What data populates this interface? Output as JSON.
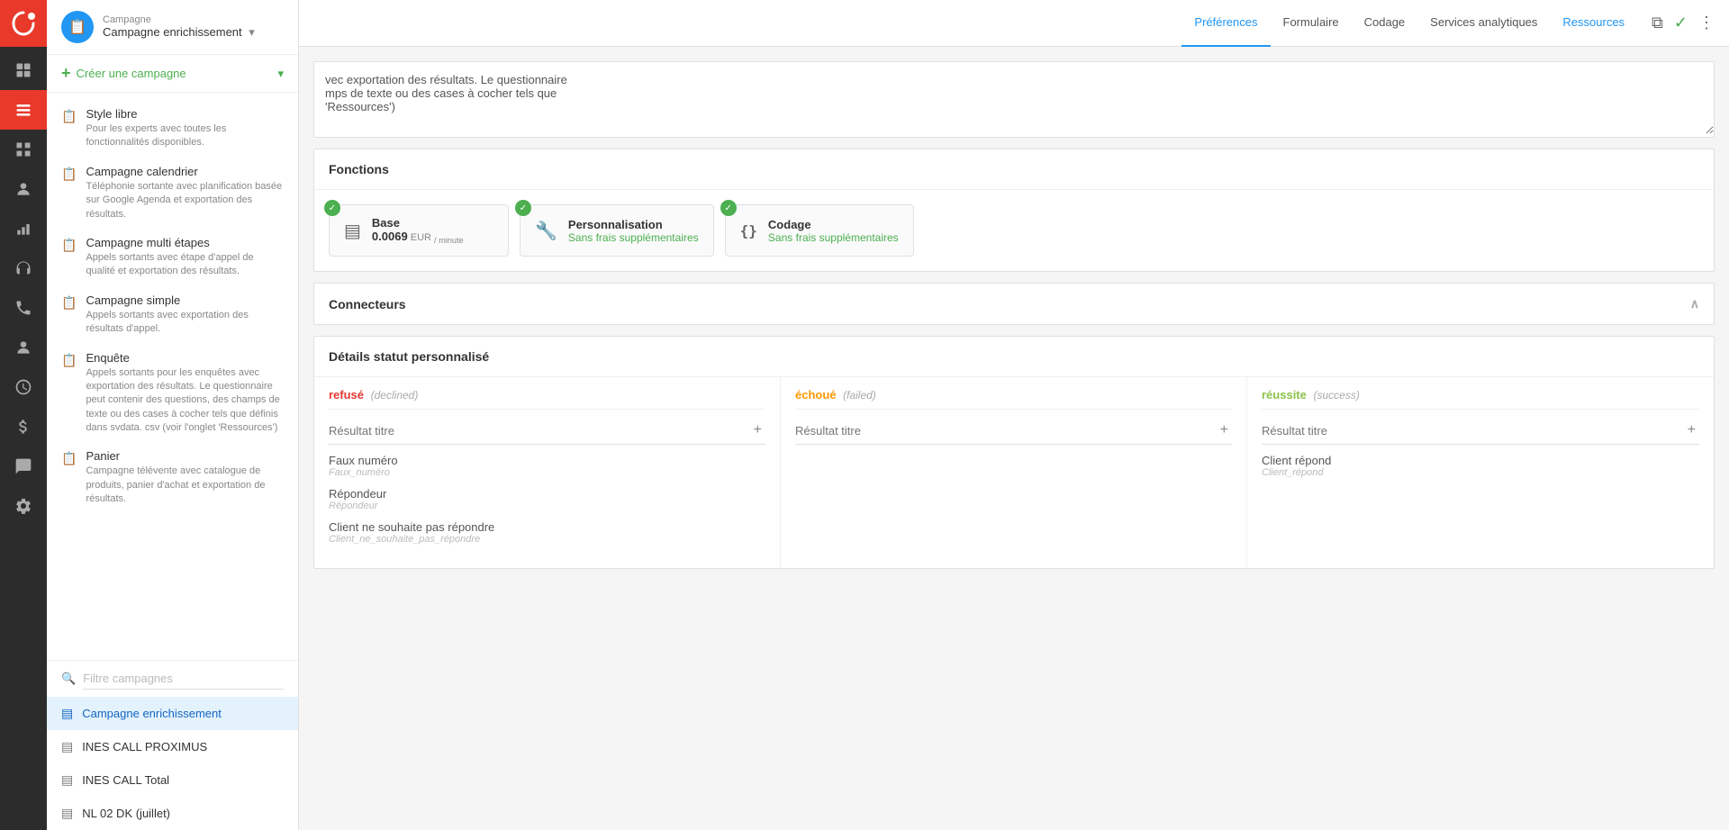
{
  "sidebar": {
    "campaign_label": "Campagne",
    "campaign_name": "Campagne enrichissement",
    "create_label": "Créer une campagne",
    "campaign_types": [
      {
        "name": "Style libre",
        "desc": "Pour les experts avec toutes les fonctionnalités disponibles."
      },
      {
        "name": "Campagne calendrier",
        "desc": "Téléphonie sortante avec planification basée sur Google Agenda et exportation des résultats."
      },
      {
        "name": "Campagne multi étapes",
        "desc": "Appels sortants avec étape d'appel de qualité et exportation des résultats."
      },
      {
        "name": "Campagne simple",
        "desc": "Appels sortants avec exportation des résultats d'appel."
      },
      {
        "name": "Enquête",
        "desc": "Appels sortants pour les enquêtes avec exportation des résultats. Le questionnaire peut contenir des questions, des champs de texte ou des cases à cocher tels que définis dans svdata. csv (voir l'onglet 'Ressources')"
      },
      {
        "name": "Panier",
        "desc": "Campagne télévente avec catalogue de produits, panier d'achat et exportation de résultats."
      }
    ],
    "filter_placeholder": "Filtre campagnes",
    "campaigns": [
      {
        "name": "Campagne enrichissement",
        "active": true
      },
      {
        "name": "INES CALL PROXIMUS",
        "active": false
      },
      {
        "name": "INES CALL Total",
        "active": false
      },
      {
        "name": "NL 02 DK (juillet)",
        "active": false
      }
    ]
  },
  "topnav": {
    "tabs": [
      {
        "label": "Préférences",
        "active": true
      },
      {
        "label": "Formulaire",
        "active": false
      },
      {
        "label": "Codage",
        "active": false
      },
      {
        "label": "Services analytiques",
        "active": false
      },
      {
        "label": "Ressources",
        "active": false,
        "highlight": true
      }
    ]
  },
  "description_textarea": {
    "value": "vec exportation des résultats. Le questionnaire\nmps de texte ou des cases à cocher tels que\n'Ressources')"
  },
  "fonctions": {
    "title": "Fonctions",
    "items": [
      {
        "icon": "▤",
        "name": "Base",
        "price": "0.0069",
        "currency": "EUR",
        "per": "/ minute"
      },
      {
        "icon": "🔧",
        "name": "Personnalisation",
        "free": "Sans frais supplémentaires"
      },
      {
        "icon": "{}",
        "name": "Codage",
        "free": "Sans frais supplémentaires"
      }
    ]
  },
  "connecteurs": {
    "title": "Connecteurs"
  },
  "details_statut": {
    "title": "Détails statut personnalisé",
    "columns": [
      {
        "label": "refusé",
        "sub": "(declined)",
        "type": "refused",
        "result_placeholder": "Résultat titre",
        "items": [
          {
            "name": "Faux numéro",
            "key": "Faux_numéro"
          },
          {
            "name": "Répondeur",
            "key": "Répondeur"
          },
          {
            "name": "Client ne souhaite pas répondre",
            "key": "Client_ne_souhaite_pas_répondre"
          }
        ]
      },
      {
        "label": "échoué",
        "sub": "(failed)",
        "type": "failed",
        "result_placeholder": "Résultat titre",
        "items": []
      },
      {
        "label": "réussite",
        "sub": "(success)",
        "type": "success",
        "result_placeholder": "Résultat titre",
        "items": [
          {
            "name": "Client répond",
            "key": "Client_répond"
          }
        ]
      }
    ]
  }
}
